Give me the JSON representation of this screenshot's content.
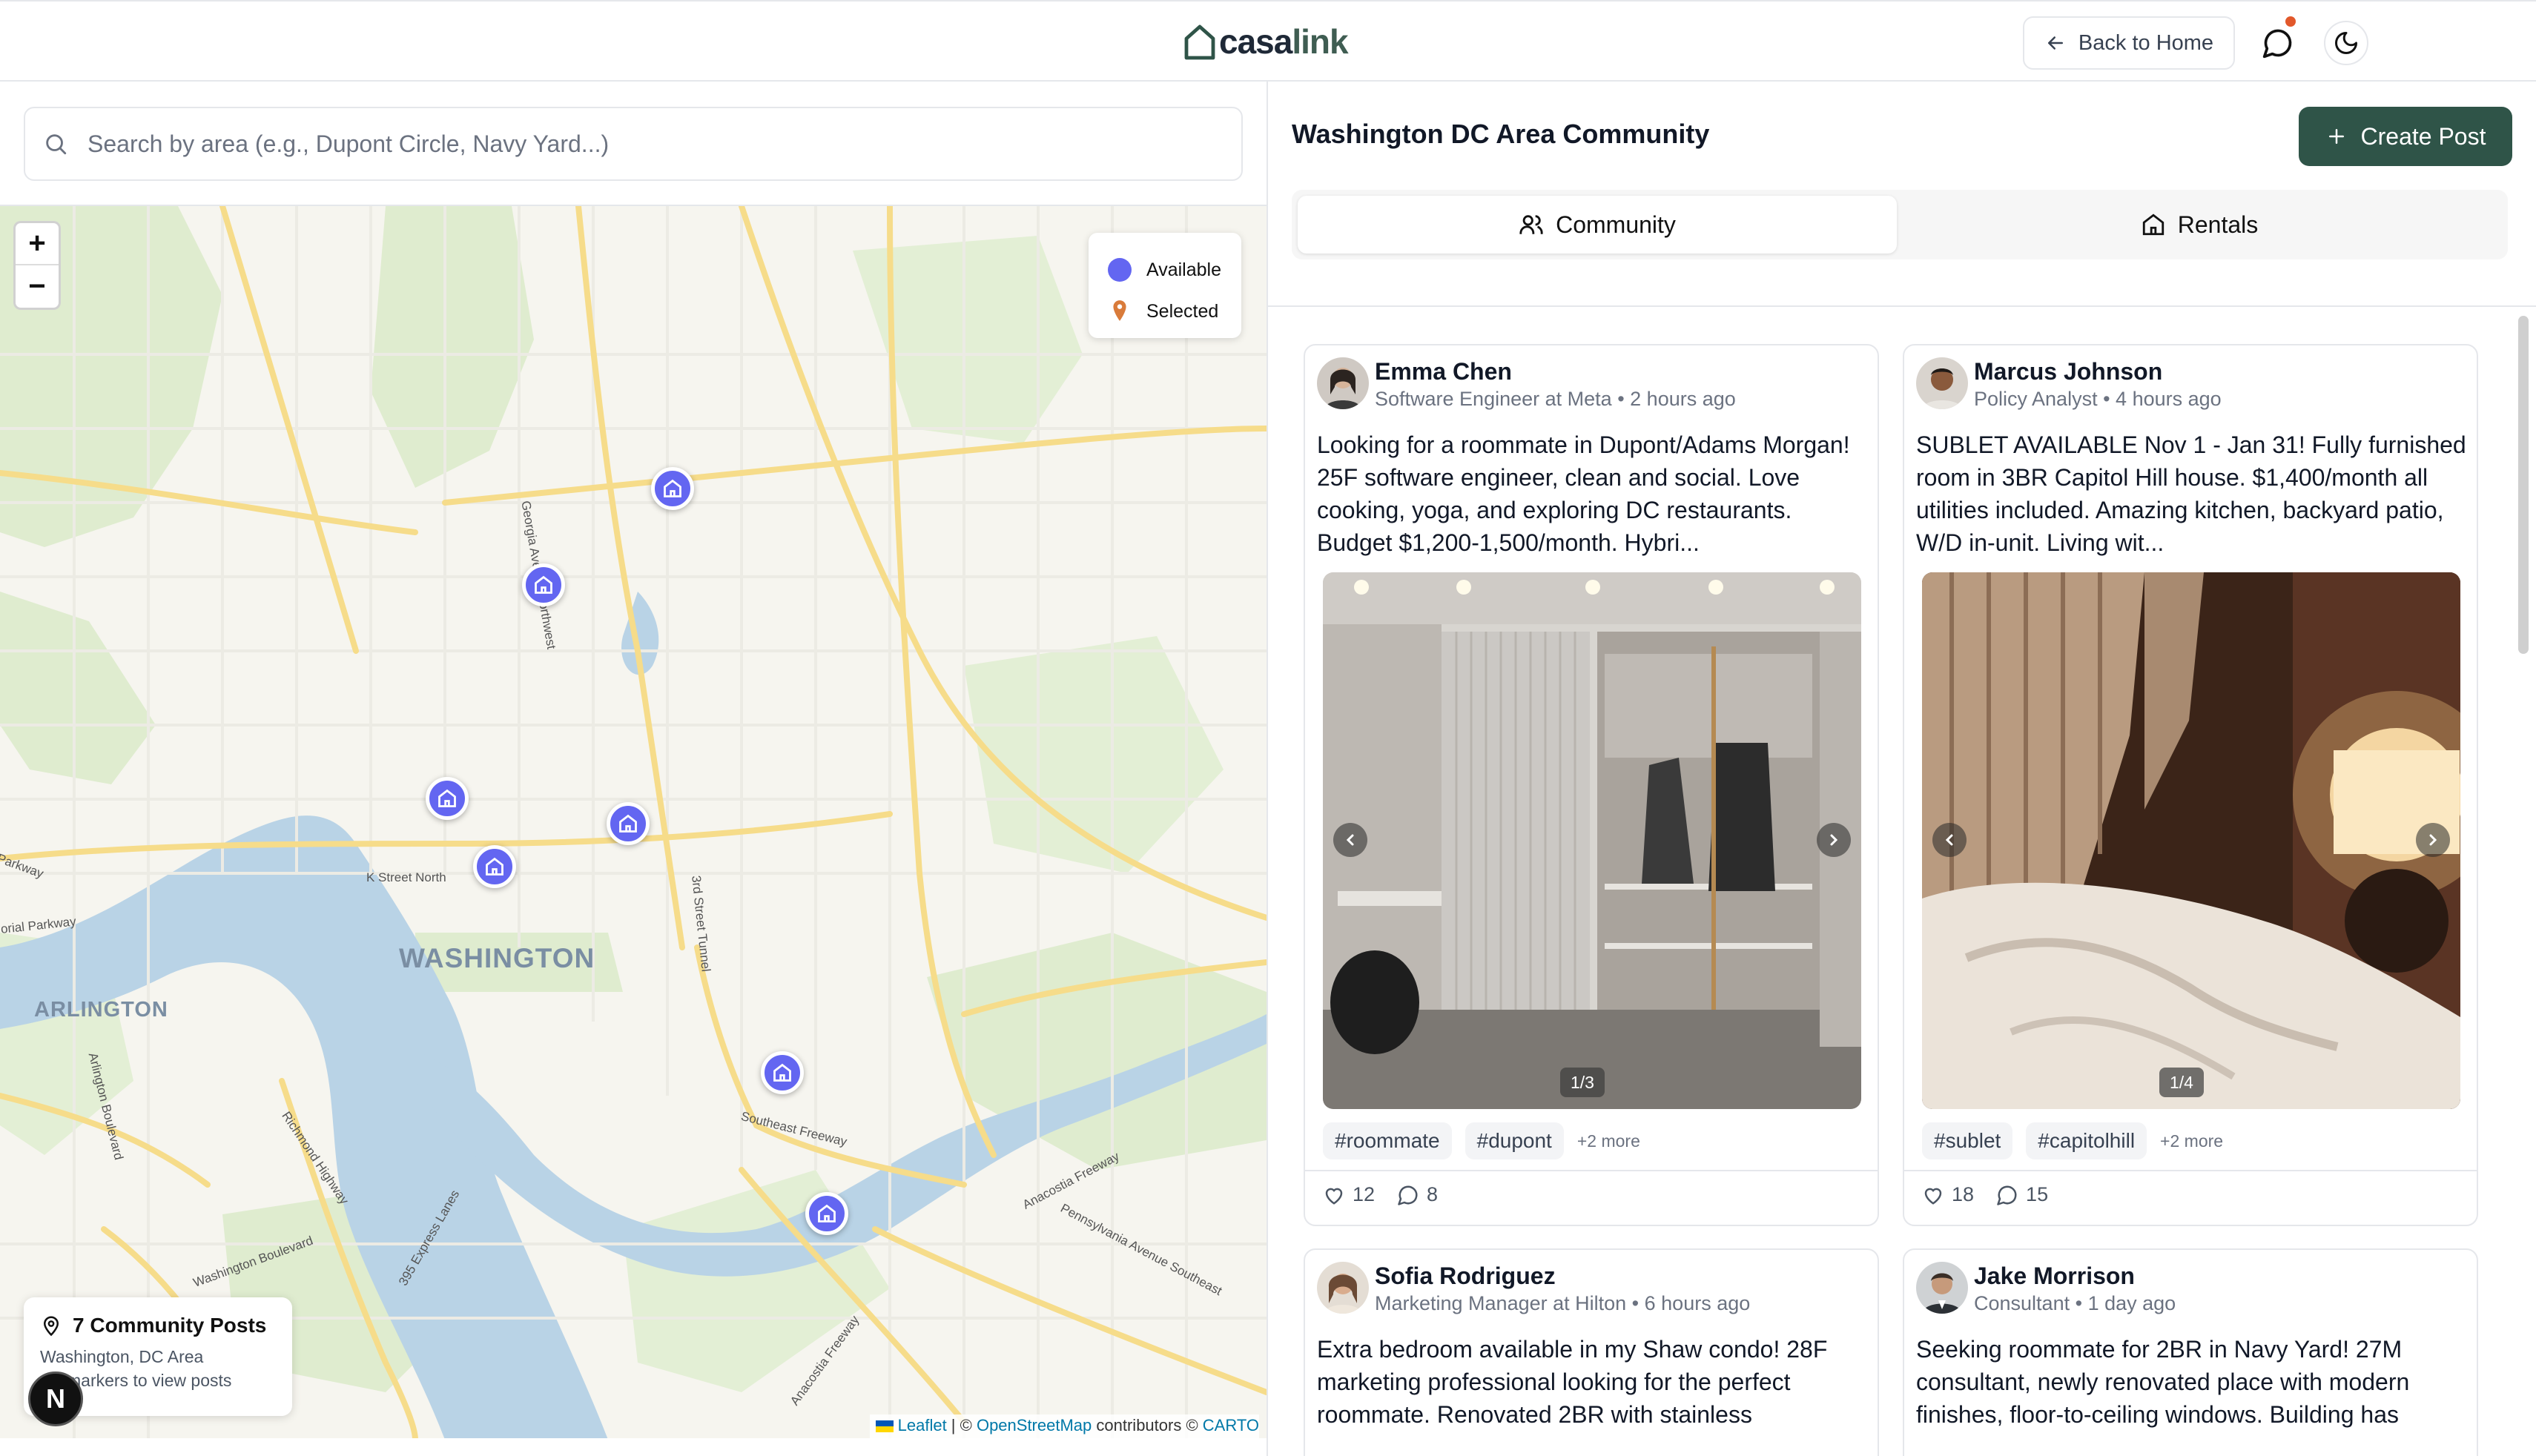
{
  "header": {
    "logo": {
      "part1": "casa",
      "part2": "link"
    },
    "back_label": "Back to Home",
    "colors": {
      "brand": "#2f5448",
      "notification_dot": "#e2582b"
    }
  },
  "search": {
    "placeholder": "Search by area (e.g., Dupont Circle, Navy Yard...)"
  },
  "map": {
    "legend": {
      "available": "Available",
      "selected": "Selected"
    },
    "labels": {
      "washington": "WASHINGTON",
      "arlington": "ARLINGTON",
      "k_street": "K Street North",
      "georgia_ave": "Georgia Avenue Northwest",
      "third_street_tunnel": "3rd Street Tunnel",
      "southeast_freeway": "Southeast Freeway",
      "anacostia_freeway": "Anacostia Freeway",
      "pennsylvania_ave": "Pennsylvania Avenue Southeast",
      "washington_blvd": "Washington Boulevard",
      "richmond_hwy": "Richmond Highway",
      "express_lanes": "395 Express Lanes",
      "arlington_blvd": "Arlington Boulevard",
      "parkway": "Parkway",
      "orial_parkway": "orial Parkway"
    },
    "posts_summary": {
      "title": "7 Community Posts",
      "area": "Washington, DC Area",
      "hint": "markers to view posts"
    },
    "attribution": {
      "leaflet": "Leaflet",
      "osm": "OpenStreetMap",
      "contributors": "contributors ©",
      "carto": "CARTO"
    },
    "marker_color": "#6366f1",
    "avatar_letter": "N"
  },
  "community": {
    "title": "Washington DC Area Community",
    "create_label": "Create Post",
    "tabs": [
      {
        "label": "Community",
        "icon": "users-icon",
        "active": true
      },
      {
        "label": "Rentals",
        "icon": "home-icon",
        "active": false
      }
    ],
    "posts": [
      {
        "author": "Emma Chen",
        "role": "Software Engineer at Meta",
        "time": "2 hours ago",
        "text": "Looking for a roommate in Dupont/Adams Morgan! 25F software engineer, clean and social. Love cooking, yoga, and exploring DC restaurants. Budget $1,200-1,500/month. Hybri...",
        "counter": "1/3",
        "tags": [
          "#roommate",
          "#dupont"
        ],
        "more": "+2 more",
        "likes": "12",
        "comments": "8"
      },
      {
        "author": "Marcus Johnson",
        "role": "Policy Analyst",
        "time": "4 hours ago",
        "text": "SUBLET AVAILABLE Nov 1 - Jan 31! Fully furnished room in 3BR Capitol Hill house. $1,400/month all utilities included. Amazing kitchen, backyard patio, W/D in-unit. Living wit...",
        "counter": "1/4",
        "tags": [
          "#sublet",
          "#capitolhill"
        ],
        "more": "+2 more",
        "likes": "18",
        "comments": "15"
      },
      {
        "author": "Sofia Rodriguez",
        "role": "Marketing Manager at Hilton",
        "time": "6 hours ago",
        "text": "Extra bedroom available in my Shaw condo! 28F marketing professional looking for the perfect roommate. Renovated 2BR with stainless"
      },
      {
        "author": "Jake Morrison",
        "role": "Consultant",
        "time": "1 day ago",
        "text": "Seeking roommate for 2BR in Navy Yard! 27M consultant, newly renovated place with modern finishes, floor-to-ceiling windows. Building has"
      }
    ]
  }
}
